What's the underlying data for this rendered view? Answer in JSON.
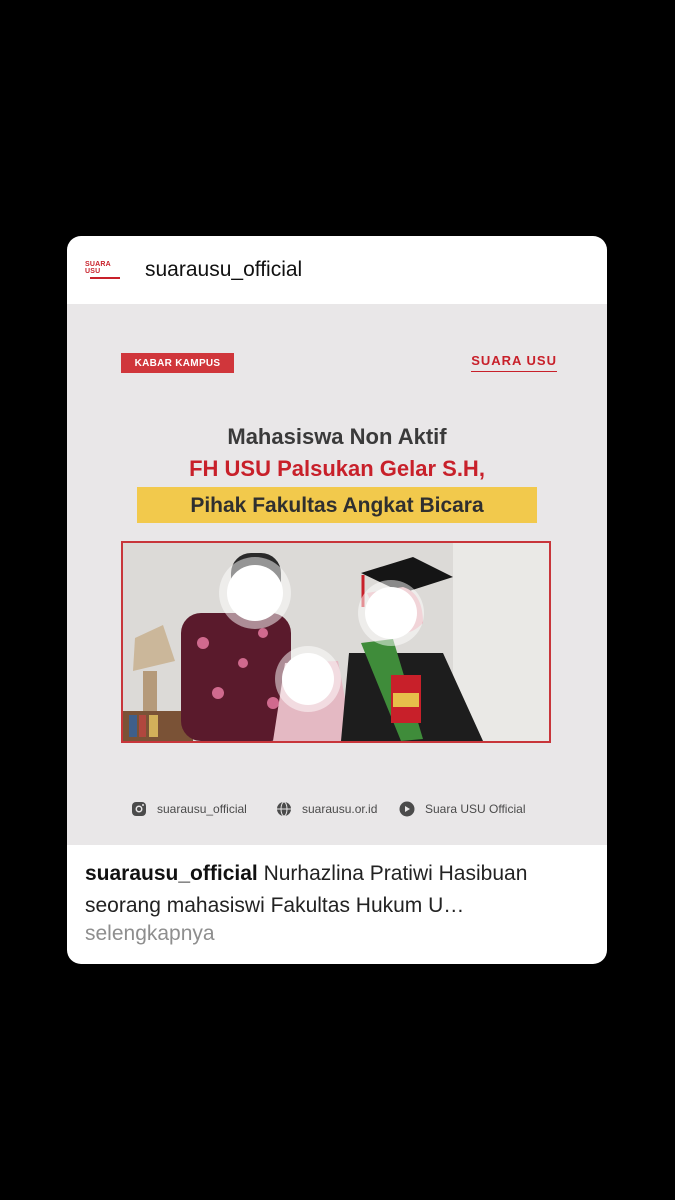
{
  "post": {
    "username": "suarausu_official",
    "avatar_logo_text": "SUARA USU",
    "image": {
      "category_badge": "KABAR KAMPUS",
      "brand_name": "SUARA USU",
      "headline_line1": "Mahasiswa Non Aktif",
      "headline_line2": "FH USU Palsukan Gelar S.H,",
      "headline_line3": "Pihak Fakultas Angkat Bicara",
      "socials": [
        {
          "icon": "instagram-icon",
          "label": "suarausu_official"
        },
        {
          "icon": "globe-icon",
          "label": "suarausu.or.id"
        },
        {
          "icon": "youtube-icon",
          "label": "Suara USU Official"
        }
      ]
    },
    "caption_username": "suarausu_official",
    "caption_text": "Nurhazlina Pratiwi Hasibuan seorang mahasiswi Fakultas Hukum U…",
    "more_label": "selengkapnya"
  },
  "colors": {
    "background": "#000000",
    "card": "#ffffff",
    "brand_red": "#c8202a",
    "highlight_yellow": "#f2c94c",
    "muted_text": "#8e8e8e"
  }
}
